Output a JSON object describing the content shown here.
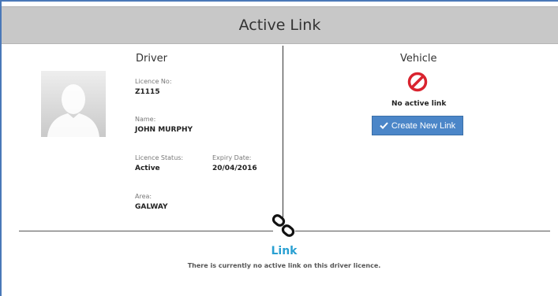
{
  "header": {
    "title": "Active Link"
  },
  "driver": {
    "title": "Driver",
    "licence_no_label": "Licence No:",
    "licence_no": "Z1115",
    "name_label": "Name:",
    "name": "JOHN MURPHY",
    "licence_status_label": "Licence Status:",
    "licence_status": "Active",
    "expiry_date_label": "Expiry Date:",
    "expiry_date": "20/04/2016",
    "area_label": "Area:",
    "area": "GALWAY"
  },
  "vehicle": {
    "title": "Vehicle",
    "status_icon": "no-entry-icon",
    "status_text": "No active link",
    "create_button_label": "Create New Link",
    "create_button_icon": "check-icon"
  },
  "link": {
    "icon": "chain-link-icon",
    "title": "Link",
    "message": "There is currently no active link on this driver licence."
  },
  "colors": {
    "header_bg": "#c8c8c8",
    "accent_blue": "#4b86c8",
    "link_title": "#2aa0d2",
    "no_icon": "#d9232e"
  }
}
